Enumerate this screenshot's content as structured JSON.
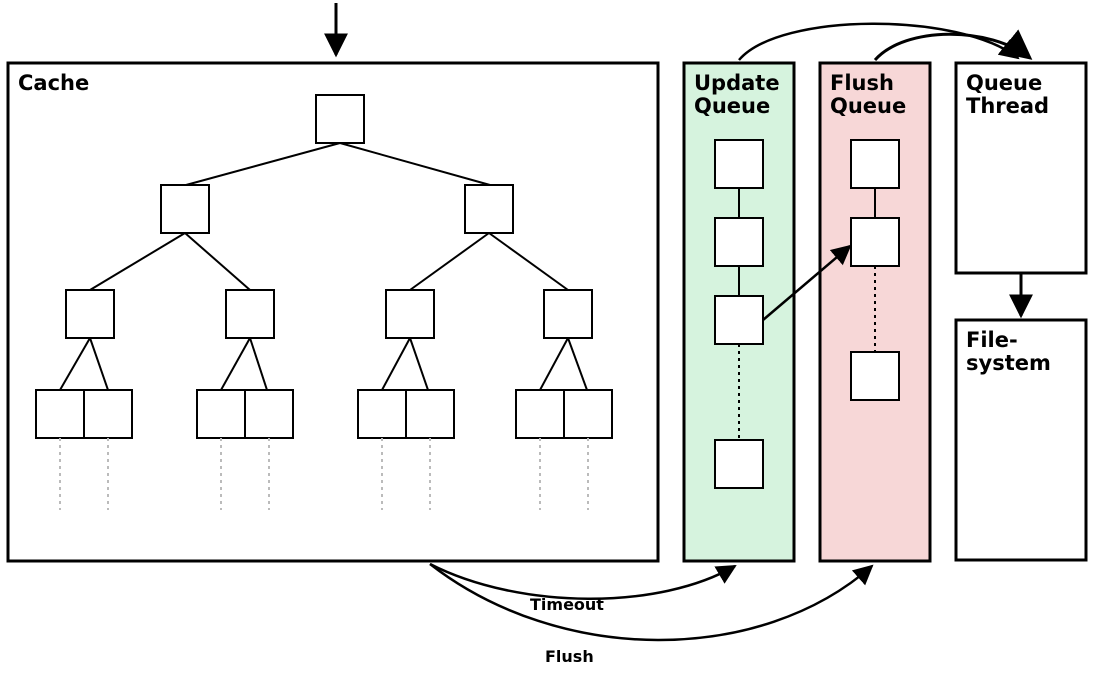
{
  "labels": {
    "cache": "Cache",
    "update_queue_l1": "Update",
    "update_queue_l2": "Queue",
    "flush_queue_l1": "Flush",
    "flush_queue_l2": "Queue",
    "queue_thread_l1": "Queue",
    "queue_thread_l2": "Thread",
    "filesystem_l1": "File-",
    "filesystem_l2": "system",
    "timeout": "Timeout",
    "flush": "Flush"
  },
  "diagram": {
    "components": [
      "Cache",
      "Update Queue",
      "Flush Queue",
      "Queue Thread",
      "Filesystem"
    ],
    "flows": [
      {
        "from": "input",
        "to": "Cache"
      },
      {
        "from": "Cache",
        "to": "Update Queue",
        "label": "Timeout"
      },
      {
        "from": "Cache",
        "to": "Flush Queue",
        "label": "Flush"
      },
      {
        "from": "Update Queue",
        "to": "Flush Queue"
      },
      {
        "from": "Update Queue",
        "to": "Queue Thread"
      },
      {
        "from": "Flush Queue",
        "to": "Queue Thread"
      },
      {
        "from": "Queue Thread",
        "to": "Filesystem"
      }
    ],
    "cache_tree_levels": 4
  }
}
